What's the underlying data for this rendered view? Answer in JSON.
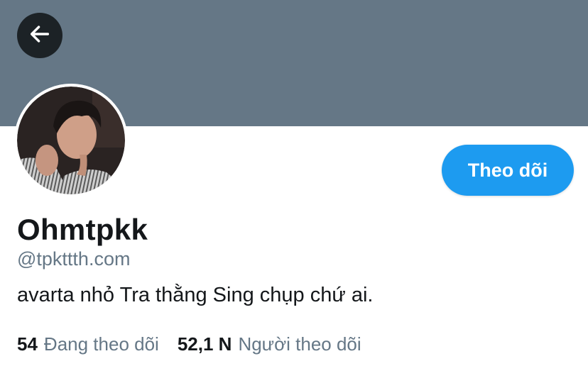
{
  "header": {
    "banner_color": "#657786",
    "back_icon": "arrow-left-icon"
  },
  "profile": {
    "display_name": "Ohmtpkk",
    "handle": "@tpkttth.com",
    "bio": "avarta nhỏ Tra thằng Sing chụp chứ ai.",
    "follow_button_label": "Theo dõi",
    "accent_color": "#1d9bf0"
  },
  "stats": {
    "following": {
      "count": "54",
      "label": "Đang theo dõi"
    },
    "followers": {
      "count": "52,1 N",
      "label": "Người theo dõi"
    }
  }
}
